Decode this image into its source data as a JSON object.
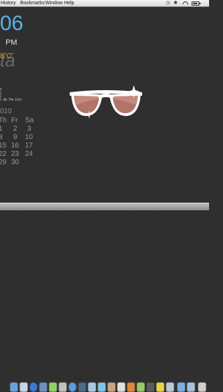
{
  "menubar": {
    "items": [
      "History",
      "Bookmarks",
      "Window",
      "Help"
    ]
  },
  "widgets": {
    "clock_time": "06",
    "ampm": "PM",
    "temperature": "8°C",
    "condition": "tá",
    "stats_lines": [
      "%",
      "C",
      "C",
      "C 80.79% Idle"
    ]
  },
  "calendar": {
    "year_fragment": "010",
    "headers": [
      "Th",
      "Fr",
      "Sa"
    ],
    "rows": [
      [
        "1",
        "2",
        "3"
      ],
      [
        "8",
        "9",
        "10"
      ],
      [
        "15",
        "16",
        "17"
      ],
      [
        "22",
        "23",
        "24"
      ],
      [
        "29",
        "30",
        ""
      ]
    ]
  },
  "icons": {
    "center": "sunglasses-icon",
    "accent_lens": "#b37368",
    "accent_clock": "#5fb0e8",
    "accent_temp": "#e0a13c"
  }
}
